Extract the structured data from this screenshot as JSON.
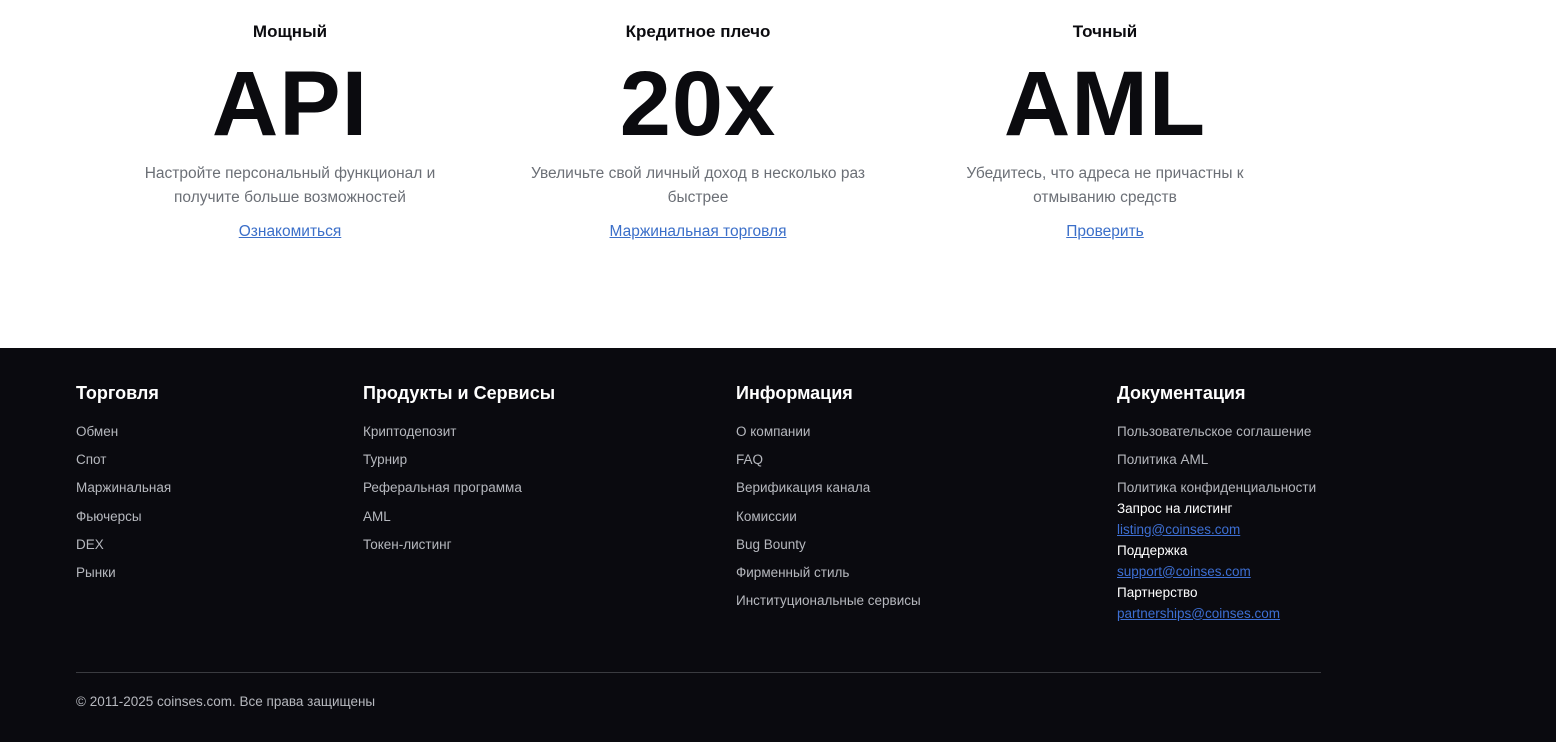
{
  "features": [
    {
      "kicker": "Мощный",
      "big": "API",
      "desc": "Настройте персональный функционал и получите больше возможностей",
      "link": "Ознакомиться"
    },
    {
      "kicker": "Кредитное плечо",
      "big": "20x",
      "desc": "Увеличьте свой личный доход в несколько раз быстрее",
      "link": "Маржинальная торговля"
    },
    {
      "kicker": "Точный",
      "big": "AML",
      "desc": "Убедитесь, что адреса не причастны к отмыванию средств",
      "link": "Проверить"
    }
  ],
  "footer": {
    "trading": {
      "title": "Торговля",
      "items": [
        "Обмен",
        "Спот",
        "Маржинальная",
        "Фьючерсы",
        "DEX",
        "Рынки"
      ]
    },
    "products": {
      "title": "Продукты и Сервисы",
      "items": [
        "Криптодепозит",
        "Турнир",
        "Реферальная программа",
        "AML",
        "Токен-листинг"
      ]
    },
    "info": {
      "title": "Информация",
      "items": [
        "О компании",
        "FAQ",
        "Верификация канала",
        "Комиссии",
        "Bug Bounty",
        "Фирменный стиль",
        "Институциональные сервисы"
      ]
    },
    "docs": {
      "title": "Документация",
      "items": [
        "Пользовательское соглашение",
        "Политика AML",
        "Политика конфиденциальности"
      ],
      "contacts": [
        {
          "label": "Запрос на листинг",
          "email": "listing@coinses.com"
        },
        {
          "label": "Поддержка",
          "email": "support@coinses.com"
        },
        {
          "label": "Партнерство",
          "email": "partnerships@coinses.com"
        }
      ]
    },
    "copyright": "© 2011-2025 coinses.com. Все права защищены"
  }
}
